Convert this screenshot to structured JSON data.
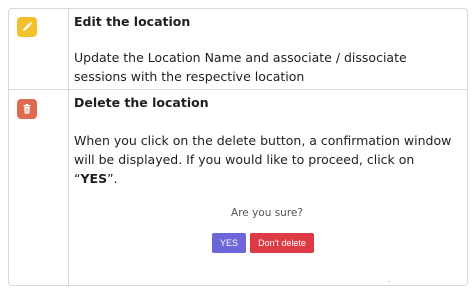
{
  "rows": [
    {
      "icon": "pencil-icon",
      "icon_color": "#f4c02c",
      "title": "Edit the location",
      "description": "Update the Location Name and associate / dissociate sessions with the respective location"
    },
    {
      "icon": "trash-icon",
      "icon_color": "#e06a4f",
      "title": "Delete the location",
      "description_before": "When you click on the delete button, a confirmation window will be displayed. If you would like to proceed, click on “",
      "description_bold": "YES",
      "description_after": "”."
    }
  ],
  "confirm_dialog": {
    "question": "Are you sure?",
    "yes_label": "YES",
    "no_label": "Don't delete",
    "yes_color": "#6c66d9",
    "no_color": "#dd3a45"
  }
}
